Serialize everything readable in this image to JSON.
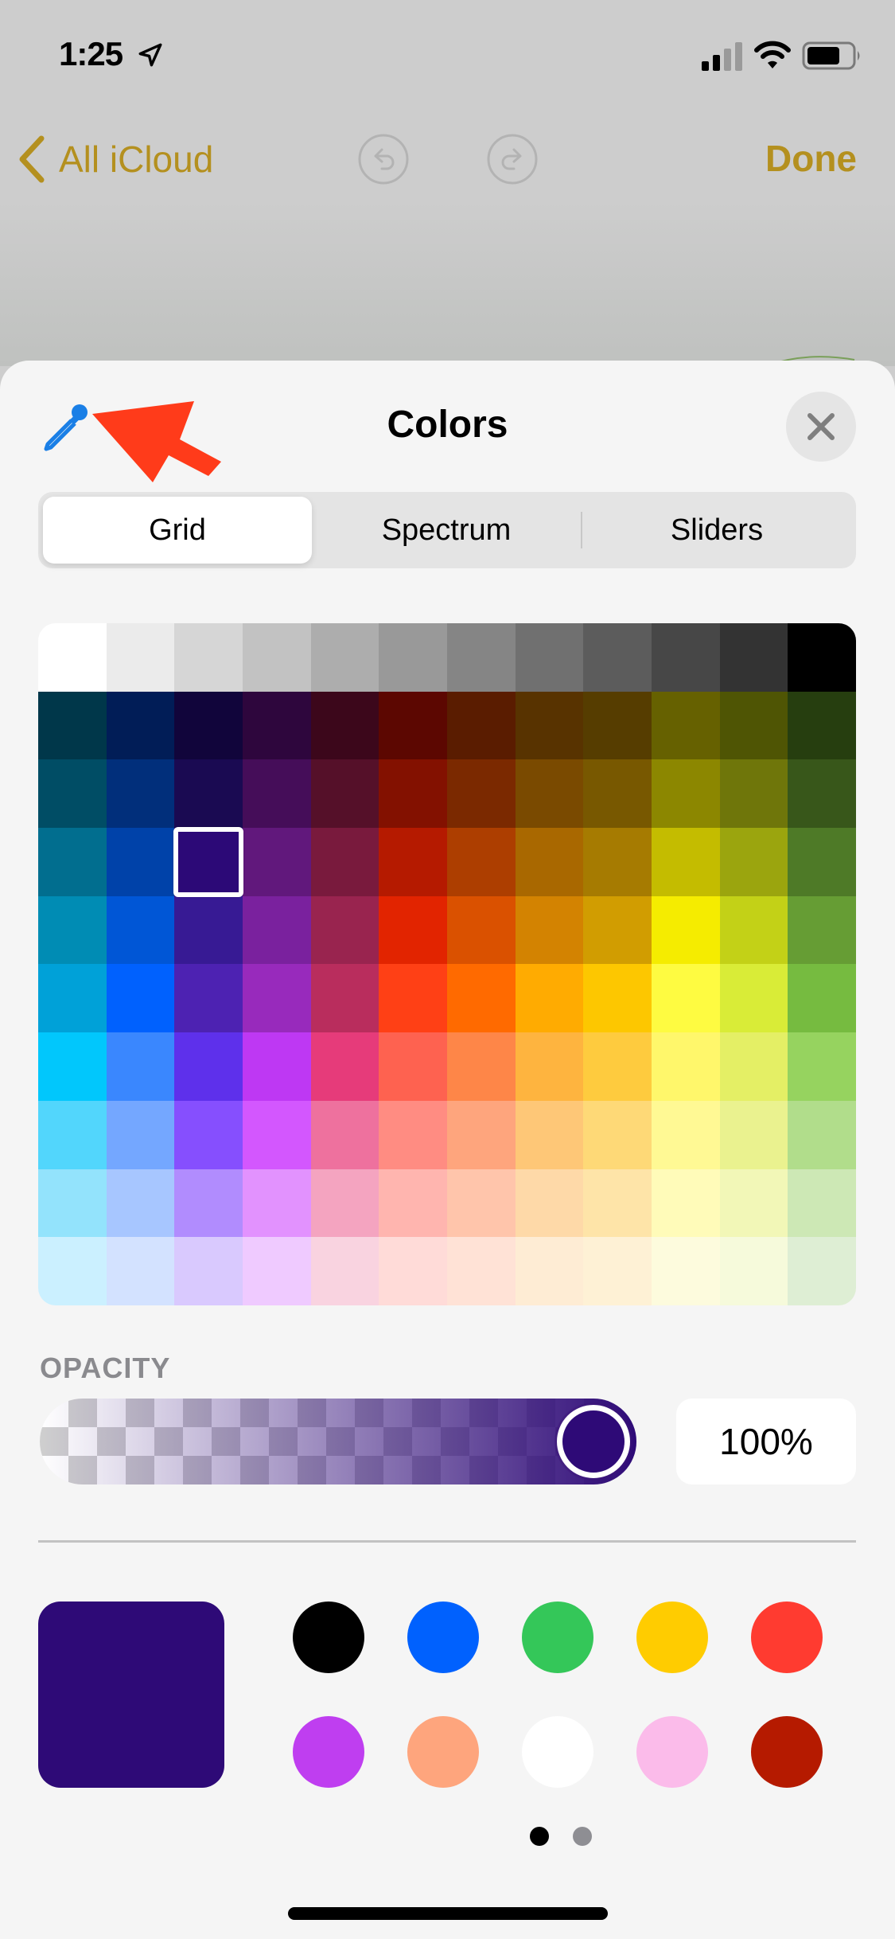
{
  "status_bar": {
    "time": "1:25",
    "icons": [
      "location-arrow-icon",
      "cellular-signal-icon",
      "wifi-icon",
      "battery-icon"
    ],
    "signal_bars_active": 2,
    "signal_bars_total": 4,
    "battery_level": 0.7
  },
  "nav": {
    "back_label": "All iCloud",
    "done_label": "Done",
    "accent_color": "#b4901f",
    "undo_icon": "undo-icon",
    "redo_icon": "redo-icon"
  },
  "sheet": {
    "title": "Colors",
    "eyedropper_icon": "eyedropper-icon",
    "eyedropper_color": "#1a7fe6",
    "annotation_arrow_color": "#ff3b1a",
    "close_icon": "close-icon"
  },
  "segments": {
    "items": [
      {
        "label": "Grid",
        "active": true
      },
      {
        "label": "Spectrum",
        "active": false
      },
      {
        "label": "Sliders",
        "active": false
      }
    ]
  },
  "grid": {
    "selected": {
      "row": 3,
      "col": 2
    },
    "rows": [
      [
        "#ffffff",
        "#ebebeb",
        "#d6d6d6",
        "#c2c2c2",
        "#adadad",
        "#999999",
        "#858585",
        "#707070",
        "#5c5c5c",
        "#474747",
        "#333333",
        "#000000"
      ],
      [
        "#00374a",
        "#011d57",
        "#11053b",
        "#2e063d",
        "#3c071b",
        "#5c0701",
        "#5a1c00",
        "#583300",
        "#563d00",
        "#666100",
        "#4f5504",
        "#263e0f"
      ],
      [
        "#004d65",
        "#012f7b",
        "#1a0a52",
        "#450d59",
        "#551029",
        "#831100",
        "#7b2900",
        "#7a4a00",
        "#785800",
        "#8c8700",
        "#6f760a",
        "#38571a"
      ],
      [
        "#016e8f",
        "#0042a9",
        "#2c0977",
        "#61187c",
        "#791a3d",
        "#b51a00",
        "#ad3e00",
        "#a96800",
        "#a67b01",
        "#c4bc00",
        "#9ba50e",
        "#4e7a27"
      ],
      [
        "#008cb4",
        "#0056d6",
        "#371a94",
        "#7a219e",
        "#99244f",
        "#e22400",
        "#da5100",
        "#d38301",
        "#d19d01",
        "#f5ec00",
        "#c3d117",
        "#669d34"
      ],
      [
        "#00a1d8",
        "#0061fe",
        "#4d22b2",
        "#982abc",
        "#b92d5d",
        "#ff4015",
        "#ff6a00",
        "#ffab01",
        "#fdc700",
        "#fefb41",
        "#d9ec37",
        "#76bb40"
      ],
      [
        "#01c7fc",
        "#3a87fe",
        "#5e30eb",
        "#be38f3",
        "#e63b7a",
        "#fe6250",
        "#fe8648",
        "#feb43f",
        "#fecb3e",
        "#fff76b",
        "#e4ef65",
        "#96d35f"
      ],
      [
        "#52d6fc",
        "#74a7ff",
        "#864ffe",
        "#d357fe",
        "#ee719e",
        "#ff8c82",
        "#fea57d",
        "#fec777",
        "#fed977",
        "#fff994",
        "#eaf28f",
        "#b1dd8b"
      ],
      [
        "#93e3fc",
        "#a7c6ff",
        "#b18cfe",
        "#e292fe",
        "#f4a4c0",
        "#ffb5af",
        "#ffc5ab",
        "#fed9a8",
        "#fee4a8",
        "#fffbb9",
        "#f2f7b7",
        "#cde8b5"
      ],
      [
        "#cbf0ff",
        "#d3e2ff",
        "#d9c9fe",
        "#efcaff",
        "#f9d3e0",
        "#ffdbd8",
        "#ffe2d6",
        "#feecd4",
        "#fef1d5",
        "#fdfbdd",
        "#f6fadb",
        "#deeed4"
      ]
    ]
  },
  "opacity": {
    "label": "OPACITY",
    "value_text": "100%",
    "value": 1.0
  },
  "current_color": "#2e0a77",
  "favorites": {
    "colors": [
      "#000000",
      "#0061fe",
      "#34c759",
      "#ffcc00",
      "#ff3b30",
      "#bf3ef0",
      "#fea57d",
      "#ffffff",
      "#fbbbea",
      "#b51a00"
    ],
    "page_index": 0,
    "page_count": 2
  }
}
